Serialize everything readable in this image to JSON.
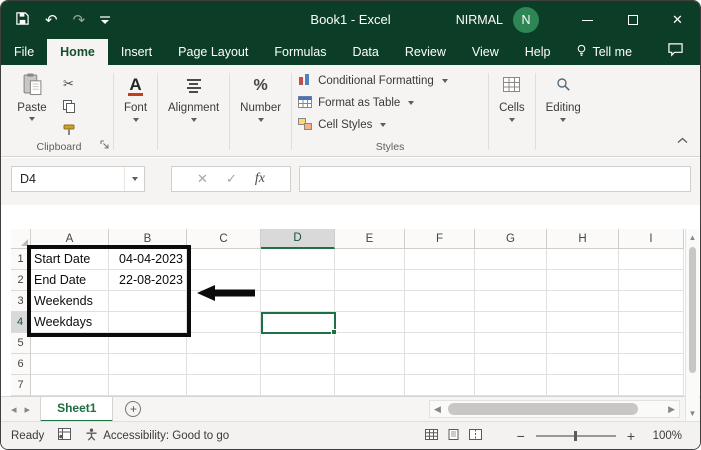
{
  "titlebar": {
    "title": "Book1 - Excel",
    "user": "NIRMAL",
    "avatar_initial": "N"
  },
  "tabs": [
    {
      "label": "File"
    },
    {
      "label": "Home",
      "active": true
    },
    {
      "label": "Insert"
    },
    {
      "label": "Page Layout"
    },
    {
      "label": "Formulas"
    },
    {
      "label": "Data"
    },
    {
      "label": "Review"
    },
    {
      "label": "View"
    },
    {
      "label": "Help"
    },
    {
      "label": "Tell me"
    }
  ],
  "ribbon": {
    "paste_label": "Paste",
    "groups": {
      "clipboard": "Clipboard",
      "styles": "Styles"
    },
    "dropdowns": {
      "font": "Font",
      "alignment": "Alignment",
      "number": "Number",
      "cells": "Cells",
      "editing": "Editing"
    },
    "styles_items": {
      "conditional_formatting": "Conditional Formatting",
      "format_as_table": "Format as Table",
      "cell_styles": "Cell Styles"
    }
  },
  "formula_bar": {
    "name_box": "D4",
    "fx": "fx",
    "value": ""
  },
  "grid": {
    "columns": [
      "A",
      "B",
      "C",
      "D",
      "E",
      "F",
      "G",
      "H",
      "I"
    ],
    "rows": [
      "1",
      "2",
      "3",
      "4",
      "5",
      "6",
      "7"
    ],
    "selected_cell": "D4",
    "selected_column": "D",
    "selected_row": "4",
    "cells": {
      "A1": {
        "text": "Start Date",
        "align": "left"
      },
      "B1": {
        "text": "04-04-2023",
        "align": "right"
      },
      "A2": {
        "text": "End Date",
        "align": "left"
      },
      "B2": {
        "text": "22-08-2023",
        "align": "right"
      },
      "A3": {
        "text": "Weekends",
        "align": "left"
      },
      "A4": {
        "text": "Weekdays",
        "align": "left"
      }
    }
  },
  "sheet_tabs": {
    "active": "Sheet1"
  },
  "status_bar": {
    "mode": "Ready",
    "accessibility": "Accessibility: Good to go",
    "zoom_level": "100%"
  },
  "glyphs": {
    "undo": "↶",
    "redo": "↷",
    "cut": "✂",
    "check": "✓",
    "cancel": "✕",
    "close": "✕",
    "nav_left": "◂",
    "nav_right": "▸",
    "scroll_up": "▲",
    "scroll_down": "▼",
    "scroll_left": "◀",
    "scroll_right": "▶",
    "add_sheet": "+",
    "zoom_out": "−",
    "zoom_in": "+",
    "percent": "%",
    "font_letter": "A"
  },
  "colors": {
    "title_green": "#0C3D26",
    "excel_green": "#217346",
    "selection_green": "#1E7145",
    "annotation_black": "#0b0b0b"
  }
}
